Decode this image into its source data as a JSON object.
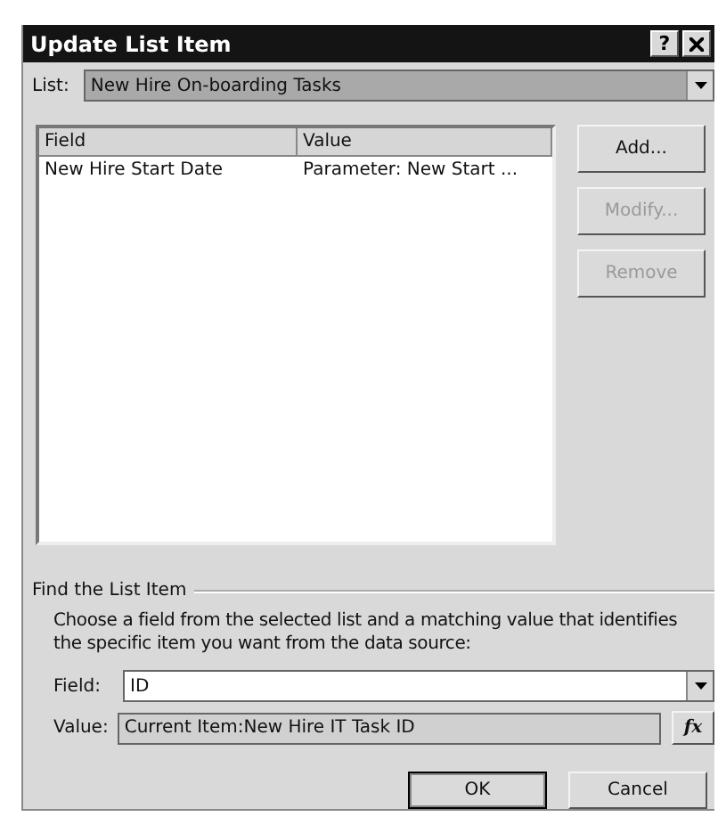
{
  "window": {
    "title": "Update List Item",
    "help_button": "?"
  },
  "list": {
    "label": "List:",
    "value": "New Hire On-boarding Tasks"
  },
  "table": {
    "columns": [
      "Field",
      "Value"
    ],
    "rows": [
      {
        "cells": [
          "New Hire Start Date",
          "Parameter: New Start ..."
        ],
        "selected": false
      }
    ]
  },
  "side_buttons": [
    {
      "label": "Add...",
      "disabled": false
    },
    {
      "label": "Modify...",
      "disabled": true
    },
    {
      "label": "Remove",
      "disabled": true
    }
  ],
  "find": {
    "title": "Find the List Item",
    "description": "Choose a field from the selected list and a matching value that identifies the specific item you want from the data source:",
    "field_label": "Field:",
    "field_value": "ID",
    "value_label": "Value:",
    "value_value": "Current Item:New Hire IT Task ID",
    "formula_button": "fx"
  },
  "buttons": [
    {
      "label": "OK",
      "default": true
    },
    {
      "label": "Cancel",
      "default": false
    }
  ]
}
